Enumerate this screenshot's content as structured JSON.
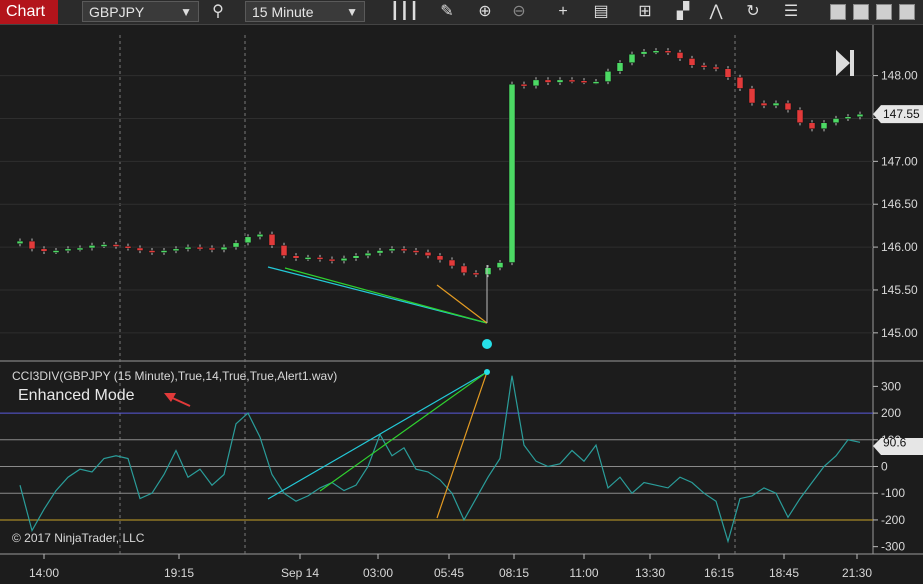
{
  "toolbar": {
    "chart_tab": "Chart",
    "instrument": "GBPJPY",
    "interval": "15 Minute"
  },
  "chart_data": [
    {
      "type": "candlestick",
      "title": "",
      "ylim": [
        144.8,
        148.45
      ],
      "y_ticks": [
        "148.00",
        "147.50",
        "147.00",
        "146.50",
        "146.00",
        "145.50",
        "145.00"
      ],
      "x_ticks": [
        "14:00",
        "19:15",
        "Sep 14",
        "03:00",
        "05:45",
        "08:15",
        "11:00",
        "13:30",
        "16:15",
        "18:45",
        "21:30"
      ],
      "last_price_label": "147.55",
      "series": [
        {
          "name": "",
          "points": [
            [
              0,
              146.07
            ],
            [
              1,
              145.98
            ],
            [
              2,
              145.95
            ],
            [
              3,
              145.96
            ],
            [
              4,
              145.98
            ],
            [
              5,
              145.99
            ],
            [
              6,
              146.02
            ],
            [
              7,
              146.03
            ],
            [
              8,
              146.01
            ],
            [
              9,
              145.99
            ],
            [
              10,
              145.96
            ],
            [
              11,
              145.94
            ],
            [
              12,
              145.96
            ],
            [
              13,
              145.98
            ],
            [
              14,
              146.0
            ],
            [
              15,
              145.99
            ],
            [
              16,
              145.97
            ],
            [
              17,
              146.0
            ],
            [
              18,
              146.05
            ],
            [
              19,
              146.12
            ],
            [
              20,
              146.15
            ],
            [
              21,
              146.02
            ],
            [
              22,
              145.9
            ],
            [
              23,
              145.87
            ],
            [
              24,
              145.88
            ],
            [
              25,
              145.86
            ],
            [
              26,
              145.84
            ],
            [
              27,
              145.87
            ],
            [
              28,
              145.9
            ],
            [
              29,
              145.93
            ],
            [
              30,
              145.96
            ],
            [
              31,
              145.98
            ],
            [
              32,
              145.96
            ],
            [
              33,
              145.94
            ],
            [
              34,
              145.9
            ],
            [
              35,
              145.85
            ],
            [
              36,
              145.78
            ],
            [
              37,
              145.7
            ],
            [
              38,
              145.68
            ],
            [
              39,
              145.76
            ],
            [
              40,
              145.82
            ],
            [
              41,
              147.9
            ],
            [
              42,
              147.88
            ],
            [
              43,
              147.95
            ],
            [
              44,
              147.92
            ],
            [
              45,
              147.95
            ],
            [
              46,
              147.94
            ],
            [
              47,
              147.93
            ],
            [
              48,
              147.93
            ],
            [
              49,
              148.05
            ],
            [
              50,
              148.15
            ],
            [
              51,
              148.25
            ],
            [
              52,
              148.28
            ],
            [
              53,
              148.29
            ],
            [
              54,
              148.27
            ],
            [
              55,
              148.2
            ],
            [
              56,
              148.12
            ],
            [
              57,
              148.1
            ],
            [
              58,
              148.08
            ],
            [
              59,
              147.98
            ],
            [
              60,
              147.85
            ],
            [
              61,
              147.68
            ],
            [
              62,
              147.65
            ],
            [
              63,
              147.68
            ],
            [
              64,
              147.6
            ],
            [
              65,
              147.45
            ],
            [
              66,
              147.38
            ],
            [
              67,
              147.45
            ],
            [
              68,
              147.5
            ],
            [
              69,
              147.52
            ],
            [
              70,
              147.55
            ]
          ]
        }
      ]
    },
    {
      "type": "line",
      "title": "CCI3DIV(GBPJPY (15 Minute),True,14,True,True,Alert1.wav)",
      "annotation": "Enhanced Mode",
      "ylim": [
        -320,
        380
      ],
      "y_ticks": [
        "300",
        "200",
        "100",
        "0",
        "-100",
        "-200",
        "-300"
      ],
      "last_value_label": "90.6",
      "levels": [
        200,
        100,
        0,
        -100,
        -200
      ],
      "series": [
        {
          "name": "",
          "points": [
            [
              0,
              -70
            ],
            [
              1,
              -240
            ],
            [
              2,
              -160
            ],
            [
              3,
              -90
            ],
            [
              4,
              -40
            ],
            [
              5,
              -10
            ],
            [
              6,
              -20
            ],
            [
              7,
              30
            ],
            [
              8,
              40
            ],
            [
              9,
              30
            ],
            [
              10,
              -120
            ],
            [
              11,
              -100
            ],
            [
              12,
              -30
            ],
            [
              13,
              60
            ],
            [
              14,
              -40
            ],
            [
              15,
              -10
            ],
            [
              16,
              -70
            ],
            [
              17,
              -30
            ],
            [
              18,
              160
            ],
            [
              19,
              200
            ],
            [
              20,
              110
            ],
            [
              21,
              -30
            ],
            [
              22,
              -100
            ],
            [
              23,
              -130
            ],
            [
              24,
              -110
            ],
            [
              25,
              -80
            ],
            [
              26,
              -60
            ],
            [
              27,
              -90
            ],
            [
              28,
              -70
            ],
            [
              29,
              0
            ],
            [
              30,
              120
            ],
            [
              31,
              40
            ],
            [
              32,
              70
            ],
            [
              33,
              -10
            ],
            [
              34,
              -20
            ],
            [
              35,
              -50
            ],
            [
              36,
              -100
            ],
            [
              37,
              -200
            ],
            [
              38,
              -120
            ],
            [
              39,
              -40
            ],
            [
              40,
              30
            ],
            [
              41,
              340
            ],
            [
              42,
              80
            ],
            [
              43,
              20
            ],
            [
              44,
              0
            ],
            [
              45,
              10
            ],
            [
              46,
              60
            ],
            [
              47,
              20
            ],
            [
              48,
              80
            ],
            [
              49,
              -80
            ],
            [
              50,
              -40
            ],
            [
              51,
              -100
            ],
            [
              52,
              -60
            ],
            [
              53,
              -70
            ],
            [
              54,
              -80
            ],
            [
              55,
              -40
            ],
            [
              56,
              -60
            ],
            [
              57,
              -100
            ],
            [
              58,
              -130
            ],
            [
              59,
              -280
            ],
            [
              60,
              -120
            ],
            [
              61,
              -110
            ],
            [
              62,
              -80
            ],
            [
              63,
              -100
            ],
            [
              64,
              -190
            ],
            [
              65,
              -120
            ],
            [
              66,
              -60
            ],
            [
              67,
              0
            ],
            [
              68,
              40
            ],
            [
              69,
              100
            ],
            [
              70,
              90.6
            ]
          ]
        }
      ]
    }
  ],
  "footer": {
    "copyright": "© 2017 NinjaTrader, LLC"
  }
}
